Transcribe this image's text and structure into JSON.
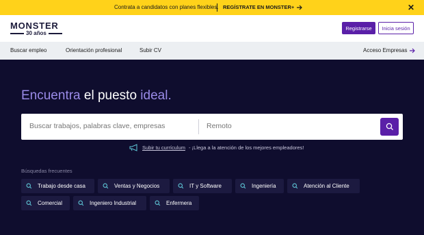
{
  "promo": {
    "message": "Contrata a candidatos con planes flexibles.",
    "cta": "REGÍSTRATE EN MONSTER+",
    "close": "✕"
  },
  "header": {
    "logo_word": "MONSTER",
    "logo_years": "30 años",
    "register": "Registrarse",
    "login": "Inicia sesión"
  },
  "nav": {
    "items": [
      "Buscar empleo",
      "Orientación profesional",
      "Subir CV"
    ],
    "employers": "Acceso Empresas"
  },
  "hero": {
    "headline_part1": "Encuentra",
    "headline_part2": " el puesto ",
    "headline_part3": "ideal."
  },
  "search": {
    "query_placeholder": "Buscar trabajos, palabras clave, empresas",
    "location_placeholder": "Remoto"
  },
  "upload": {
    "link": "Subir tu currículum",
    "text": "- ¡Llega a la atención de los mejores empleadores!"
  },
  "frequent": {
    "title": "Búsquedas frecuentes",
    "chips": [
      "Trabajo desde casa",
      "Ventas y Negocios",
      "IT y Software",
      "Ingeniería",
      "Atención al Cliente",
      "Comercial",
      "Ingeniero Industrial",
      "Enfermera"
    ]
  },
  "colors": {
    "accent": "#5a1fa8",
    "promo_bg": "#ffd21a",
    "hero_bg": "#0f0d2e",
    "headline_highlight": "#9a8be8",
    "chip_bg": "#1c1a40"
  }
}
